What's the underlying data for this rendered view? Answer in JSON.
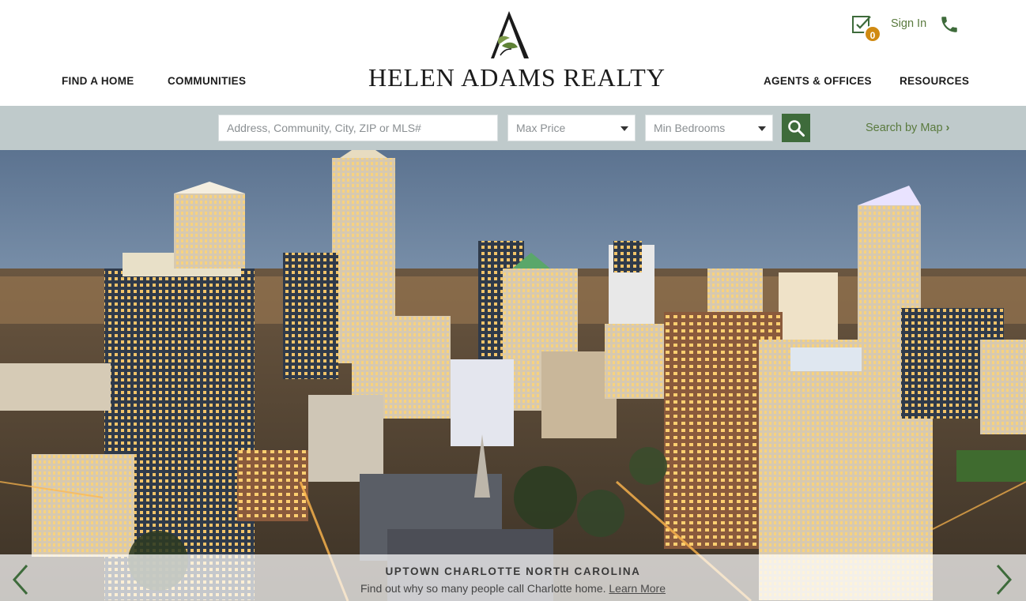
{
  "header": {
    "brand": "HELEN ADAMS REALTY",
    "nav_left": [
      "FIND A HOME",
      "COMMUNITIES"
    ],
    "nav_right": [
      "AGENTS & OFFICES",
      "RESOURCES"
    ],
    "saved_count": "0",
    "sign_in": "Sign In"
  },
  "search": {
    "placeholder": "Address, Community, City, ZIP or MLS#",
    "max_price": "Max Price",
    "min_bedrooms": "Min Bedrooms",
    "map_link": "Search by Map",
    "map_chevron": "›"
  },
  "hero": {
    "title": "UPTOWN CHARLOTTE NORTH CAROLINA",
    "subtitle": "Find out why so many people call Charlotte home.",
    "link": "Learn More"
  },
  "icons": [
    "checklist-icon",
    "phone-icon",
    "search-icon",
    "chevron-left-icon",
    "chevron-right-icon",
    "logo-mark-icon"
  ],
  "colors": {
    "brand_green": "#3e6b3b",
    "link_green": "#5a7a3e",
    "badge_orange": "#d08a12",
    "search_band": "#bfcacb"
  }
}
